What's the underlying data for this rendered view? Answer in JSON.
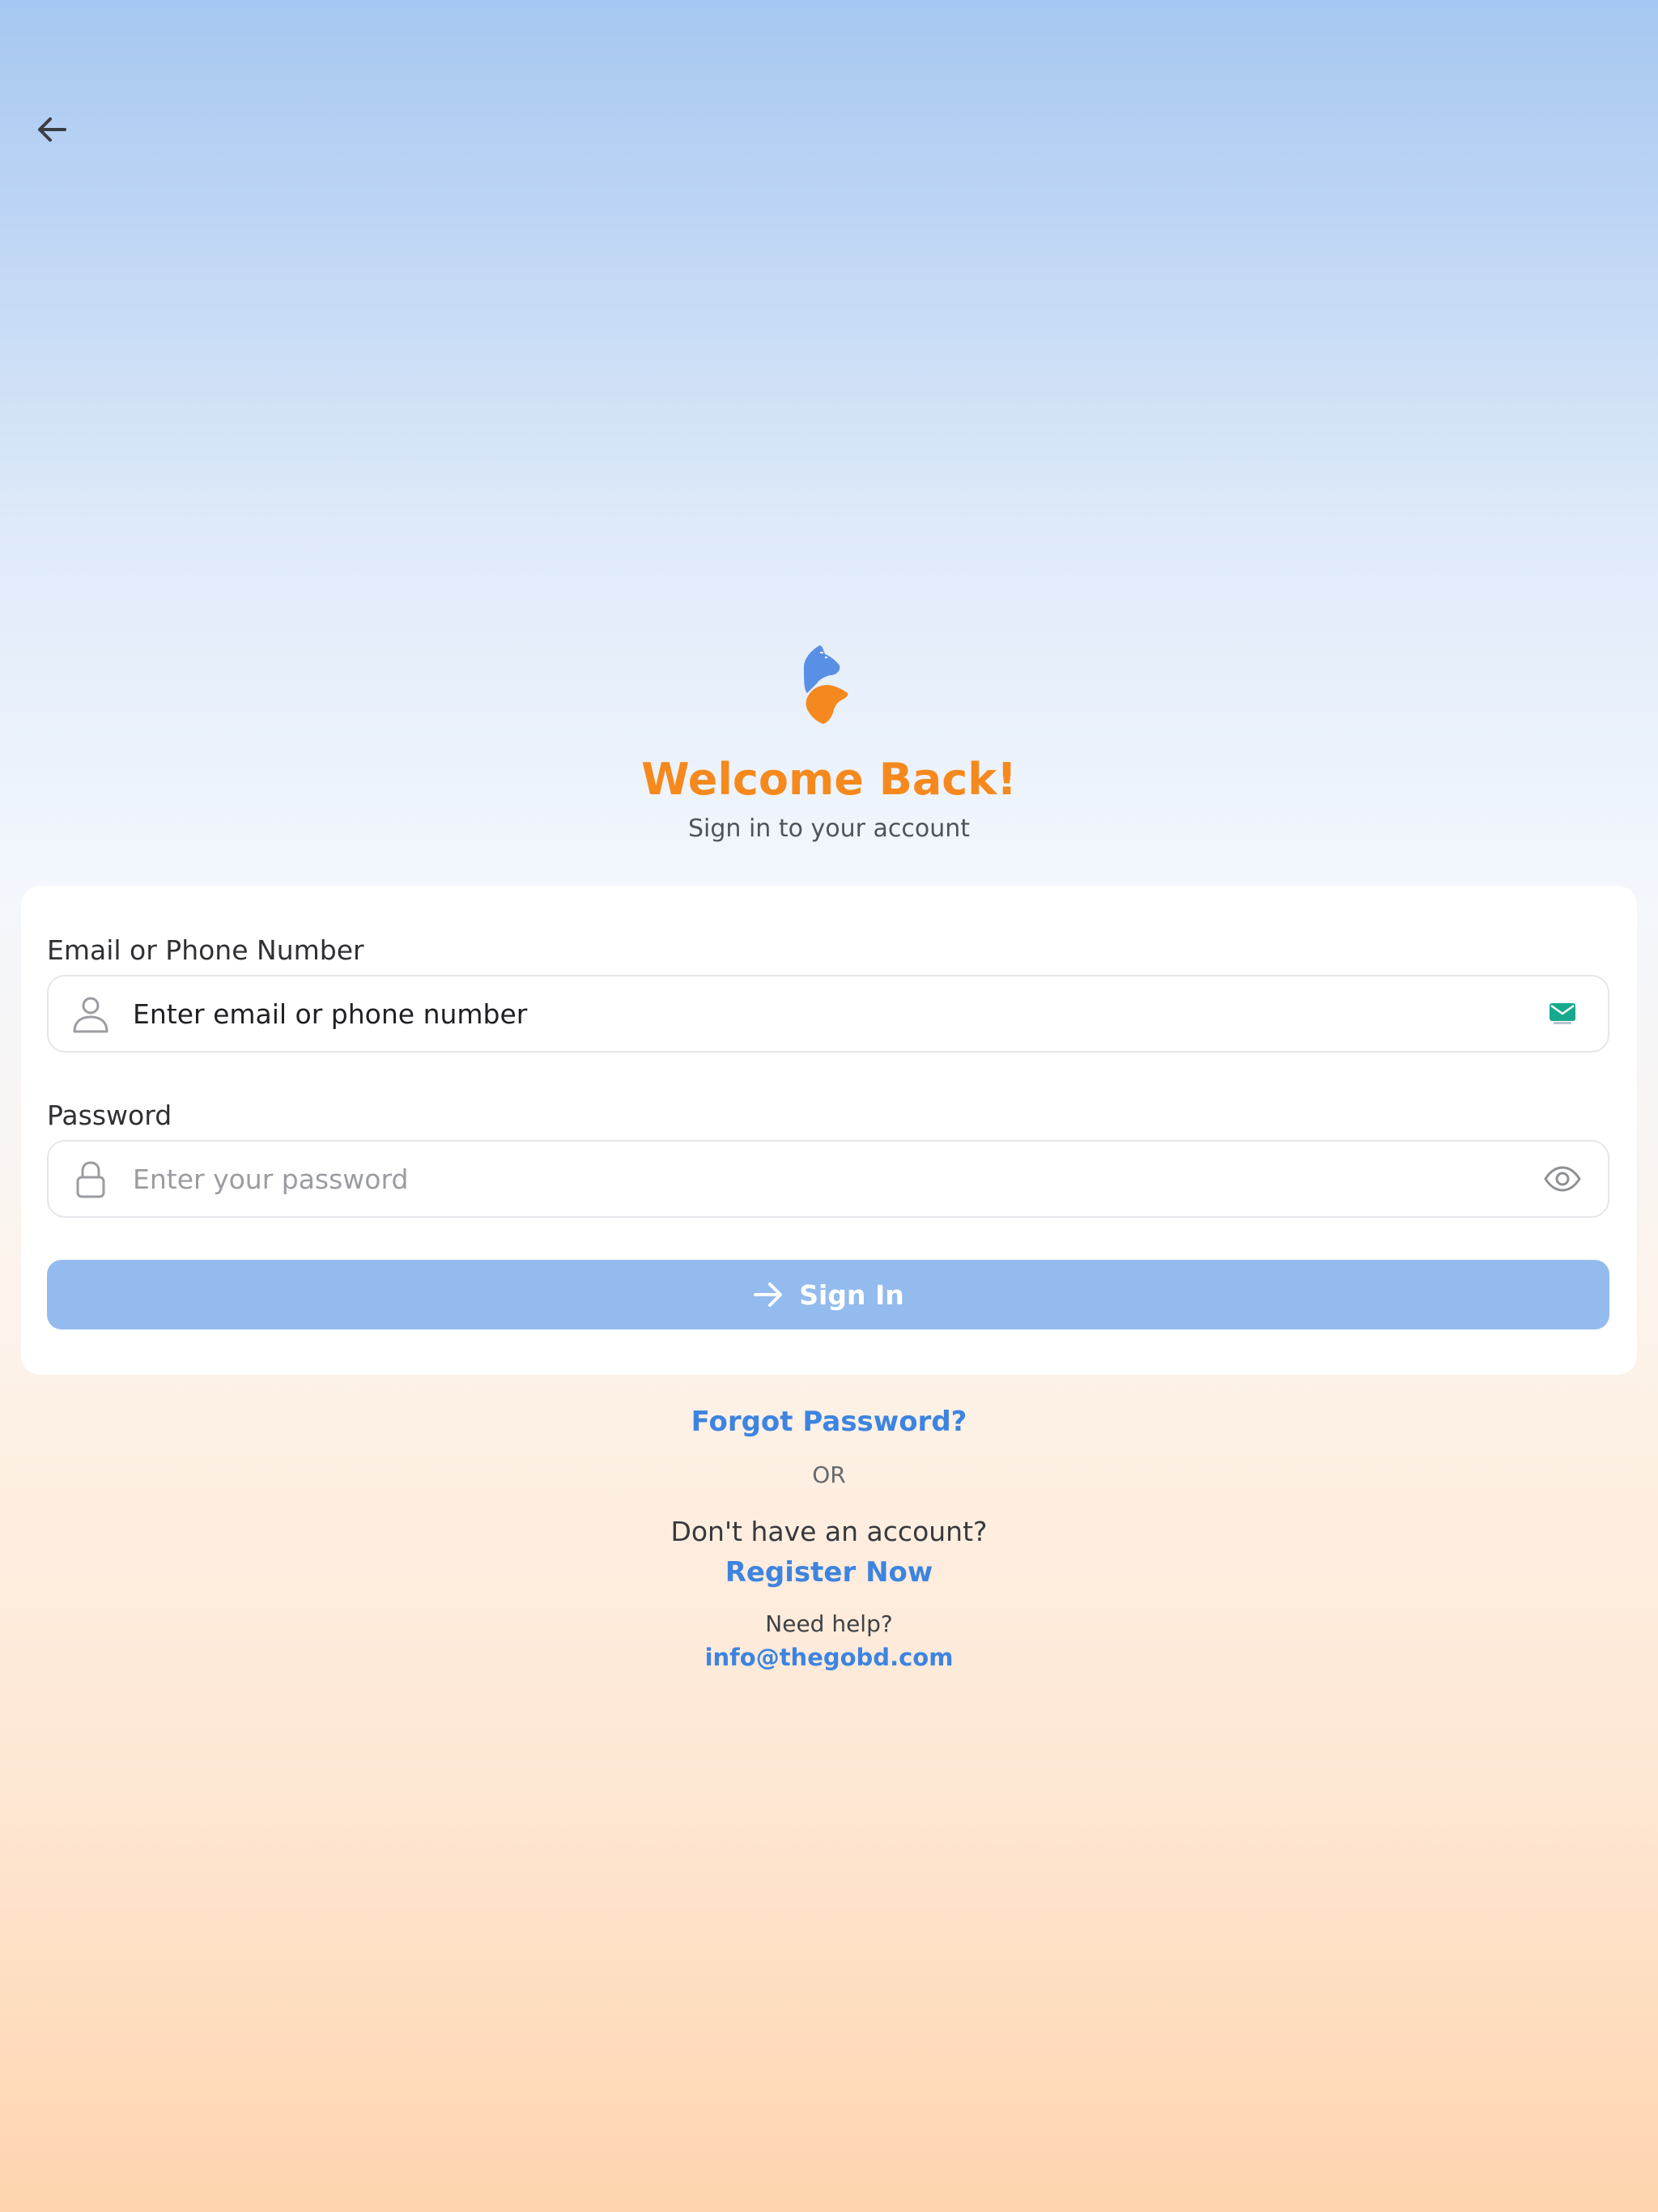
{
  "nav": {
    "back_icon": "arrow-left-icon"
  },
  "brand": {
    "logo_icon": "brand-logo",
    "colors": {
      "blue": "#5a8fe6",
      "orange": "#f5891d"
    }
  },
  "header": {
    "title": "Welcome Back!",
    "subtitle": "Sign in to your account"
  },
  "form": {
    "email": {
      "label": "Email or Phone Number",
      "placeholder": "Enter email or phone number",
      "lead_icon": "user-icon",
      "trail_icon": "mail-icon"
    },
    "password": {
      "label": "Password",
      "placeholder": "Enter your password",
      "lead_icon": "lock-icon",
      "trail_icon": "eye-icon"
    },
    "submit": {
      "label": "Sign In",
      "icon": "arrow-right-icon",
      "color": "#94bbee"
    }
  },
  "footer": {
    "forgot": "Forgot Password?",
    "or": "OR",
    "no_account": "Don't have an account?",
    "register": "Register Now",
    "need_help": "Need help?",
    "email": "info@thegobd.com",
    "link_color": "#3d84e0"
  }
}
